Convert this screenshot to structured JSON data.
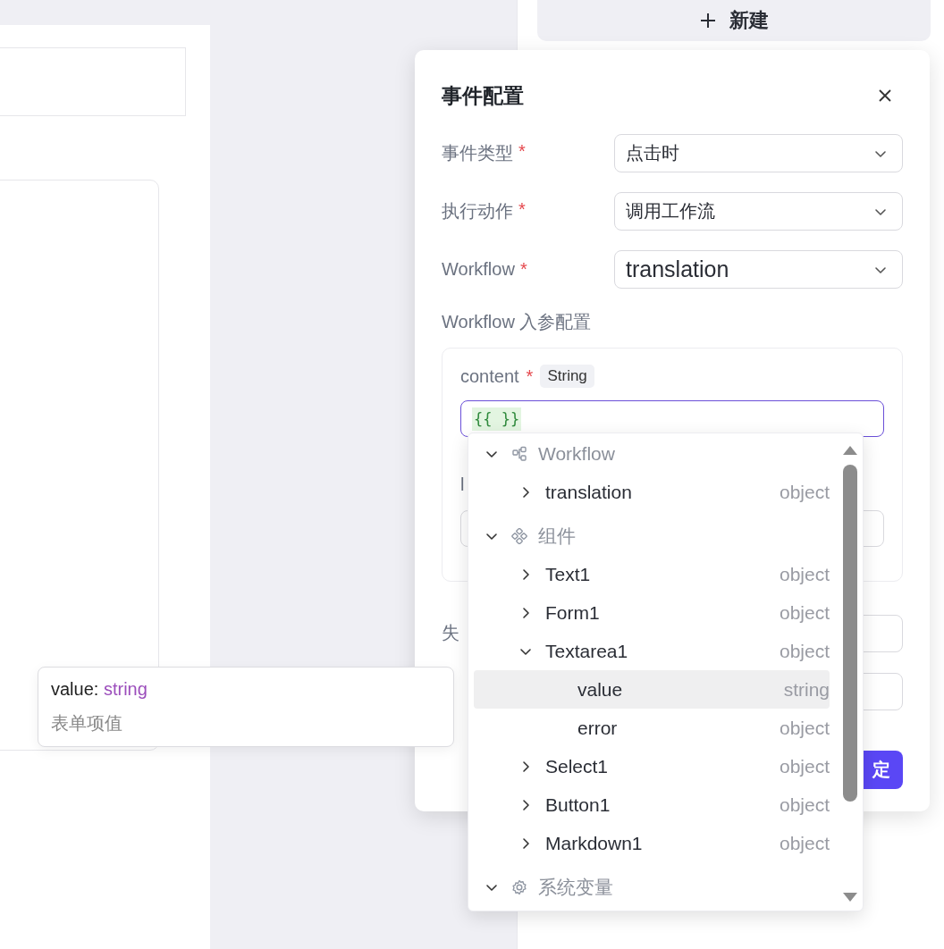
{
  "toolbar": {
    "new_button": "新建"
  },
  "dialog": {
    "title": "事件配置",
    "fields": [
      {
        "label": "事件类型",
        "required_mark": "*",
        "value": "点击时"
      },
      {
        "label": "执行动作",
        "required_mark": "*",
        "value": "调用工作流"
      },
      {
        "label": "Workflow",
        "required_mark": "*",
        "value": "translation"
      }
    ],
    "params_title": "Workflow 入参配置",
    "params": [
      {
        "name": "content",
        "required_mark": "*",
        "type": "String",
        "value": "{{ }}",
        "focused": true
      },
      {
        "name": "l",
        "focused": false
      }
    ],
    "more_fields": [
      {
        "label": "失",
        "kind": "select"
      },
      {
        "kind": "select"
      }
    ],
    "buttons": [
      {
        "label": "定",
        "kind": "primary"
      }
    ]
  },
  "variables": [
    {
      "label": "Workflow",
      "kind": "workflow",
      "expanded": true,
      "children": [
        {
          "label": "translation",
          "type": "object",
          "kind": "branch",
          "expanded": false,
          "selected": false
        }
      ]
    },
    {
      "label": "组件",
      "kind": "components",
      "expanded": true,
      "children": [
        {
          "label": "Text1",
          "type": "object",
          "kind": "branch",
          "expanded": false,
          "selected": false
        },
        {
          "label": "Form1",
          "type": "object",
          "kind": "branch",
          "expanded": false,
          "selected": false
        },
        {
          "label": "Textarea1",
          "type": "object",
          "kind": "branch",
          "expanded": true,
          "selected": false,
          "children": [
            {
              "label": "value",
              "type": "string",
              "kind": "leaf",
              "selected": true
            },
            {
              "label": "error",
              "type": "object",
              "kind": "leaf",
              "selected": false
            }
          ]
        },
        {
          "label": "Select1",
          "type": "object",
          "kind": "branch",
          "expanded": false,
          "selected": false
        },
        {
          "label": "Button1",
          "type": "object",
          "kind": "branch",
          "expanded": false,
          "selected": false
        },
        {
          "label": "Markdown1",
          "type": "object",
          "kind": "branch",
          "expanded": false,
          "selected": false
        }
      ]
    },
    {
      "label": "系统变量",
      "kind": "system",
      "expanded": true
    }
  ],
  "tooltip": {
    "label": "value:",
    "type": "string",
    "description": "表单项值"
  }
}
